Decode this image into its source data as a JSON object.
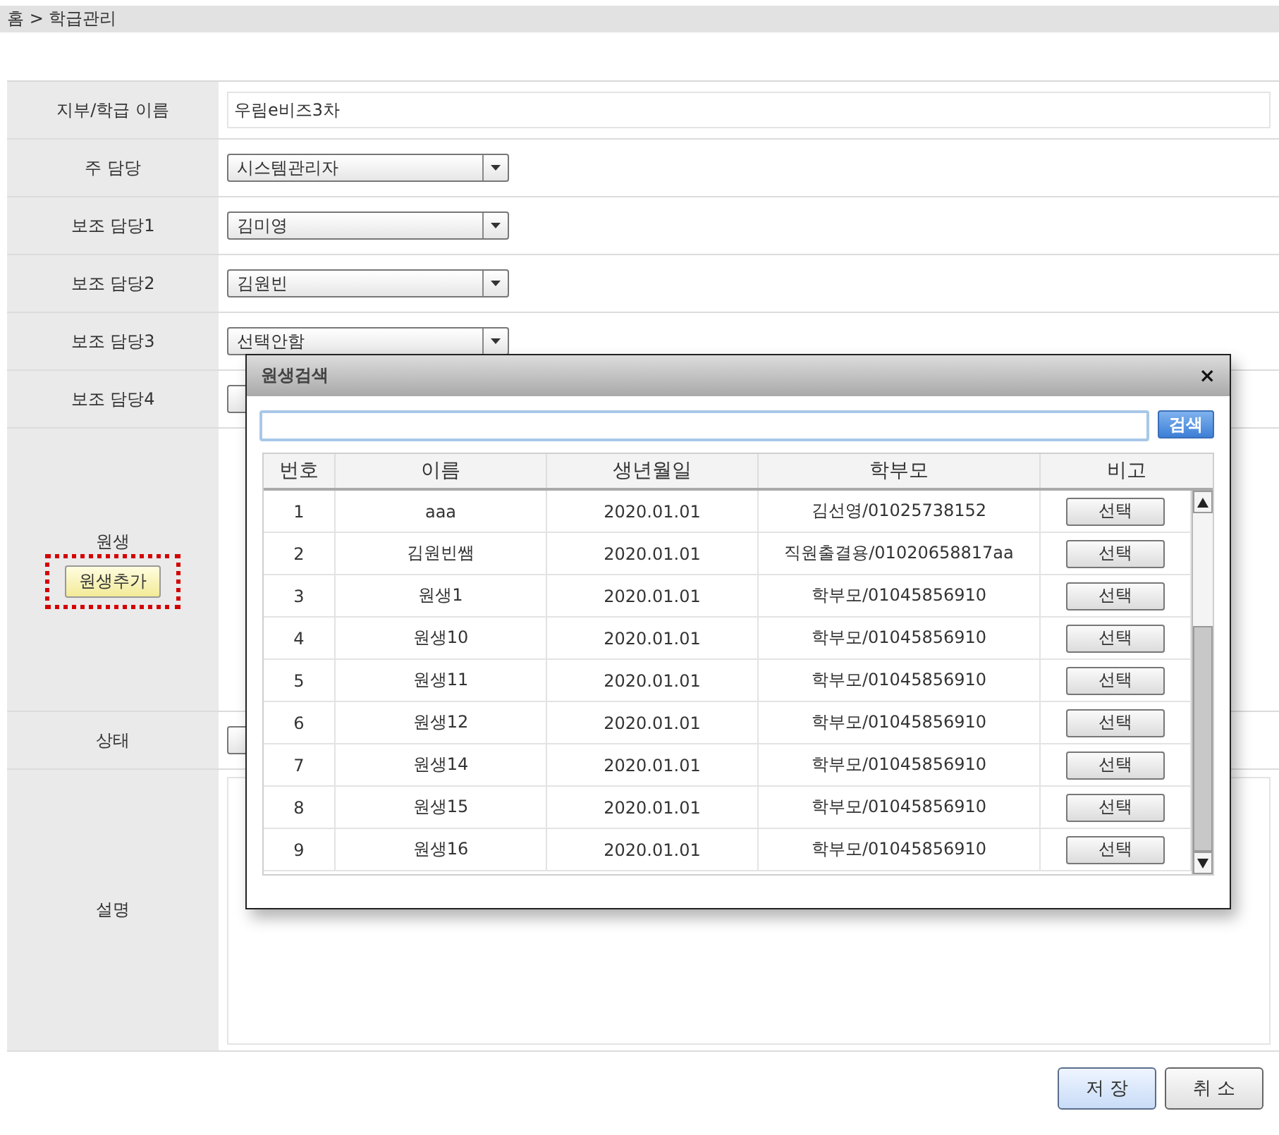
{
  "breadcrumb": "홈 > 학급관리",
  "form": [
    {
      "label": "지부/학급 이름",
      "kind": "text",
      "value": "우림e비즈3차"
    },
    {
      "label": "주 담당",
      "kind": "select",
      "value": "시스템관리자"
    },
    {
      "label": "보조 담당1",
      "kind": "select",
      "value": "김미영"
    },
    {
      "label": "보조 담당2",
      "kind": "select",
      "value": "김원빈"
    },
    {
      "label": "보조 담당3",
      "kind": "select",
      "value": "선택안함"
    },
    {
      "label": "보조 담당4",
      "kind": "select"
    },
    {
      "label": "원생",
      "kind": "students",
      "button": "원생추가",
      "highlighted": true
    },
    {
      "label": "상태",
      "kind": "select"
    },
    {
      "label": "설명",
      "kind": "textarea"
    }
  ],
  "buttons": [
    {
      "label": "저 장",
      "primary": true
    },
    {
      "label": "취 소",
      "primary": false
    }
  ],
  "dialog": {
    "title": "원생검색",
    "close": "×",
    "search_button": "검색",
    "table": {
      "columns": [
        "번호",
        "이름",
        "생년월일",
        "학부모",
        "비고"
      ],
      "rows": [
        {
          "no": "1",
          "name": "aaa",
          "birth": "2020.01.01",
          "parent": "김선영/01025738152",
          "action": "선택"
        },
        {
          "no": "2",
          "name": "김원빈쌤",
          "birth": "2020.01.01",
          "parent": "직원출결용/01020658817aa",
          "action": "선택"
        },
        {
          "no": "3",
          "name": "원생1",
          "birth": "2020.01.01",
          "parent": "학부모/01045856910",
          "action": "선택"
        },
        {
          "no": "4",
          "name": "원생10",
          "birth": "2020.01.01",
          "parent": "학부모/01045856910",
          "action": "선택"
        },
        {
          "no": "5",
          "name": "원생11",
          "birth": "2020.01.01",
          "parent": "학부모/01045856910",
          "action": "선택"
        },
        {
          "no": "6",
          "name": "원생12",
          "birth": "2020.01.01",
          "parent": "학부모/01045856910",
          "action": "선택"
        },
        {
          "no": "7",
          "name": "원생14",
          "birth": "2020.01.01",
          "parent": "학부모/01045856910",
          "action": "선택"
        },
        {
          "no": "8",
          "name": "원생15",
          "birth": "2020.01.01",
          "parent": "학부모/01045856910",
          "action": "선택"
        },
        {
          "no": "9",
          "name": "원생16",
          "birth": "2020.01.01",
          "parent": "학부모/01045856910",
          "action": "선택"
        }
      ]
    }
  }
}
